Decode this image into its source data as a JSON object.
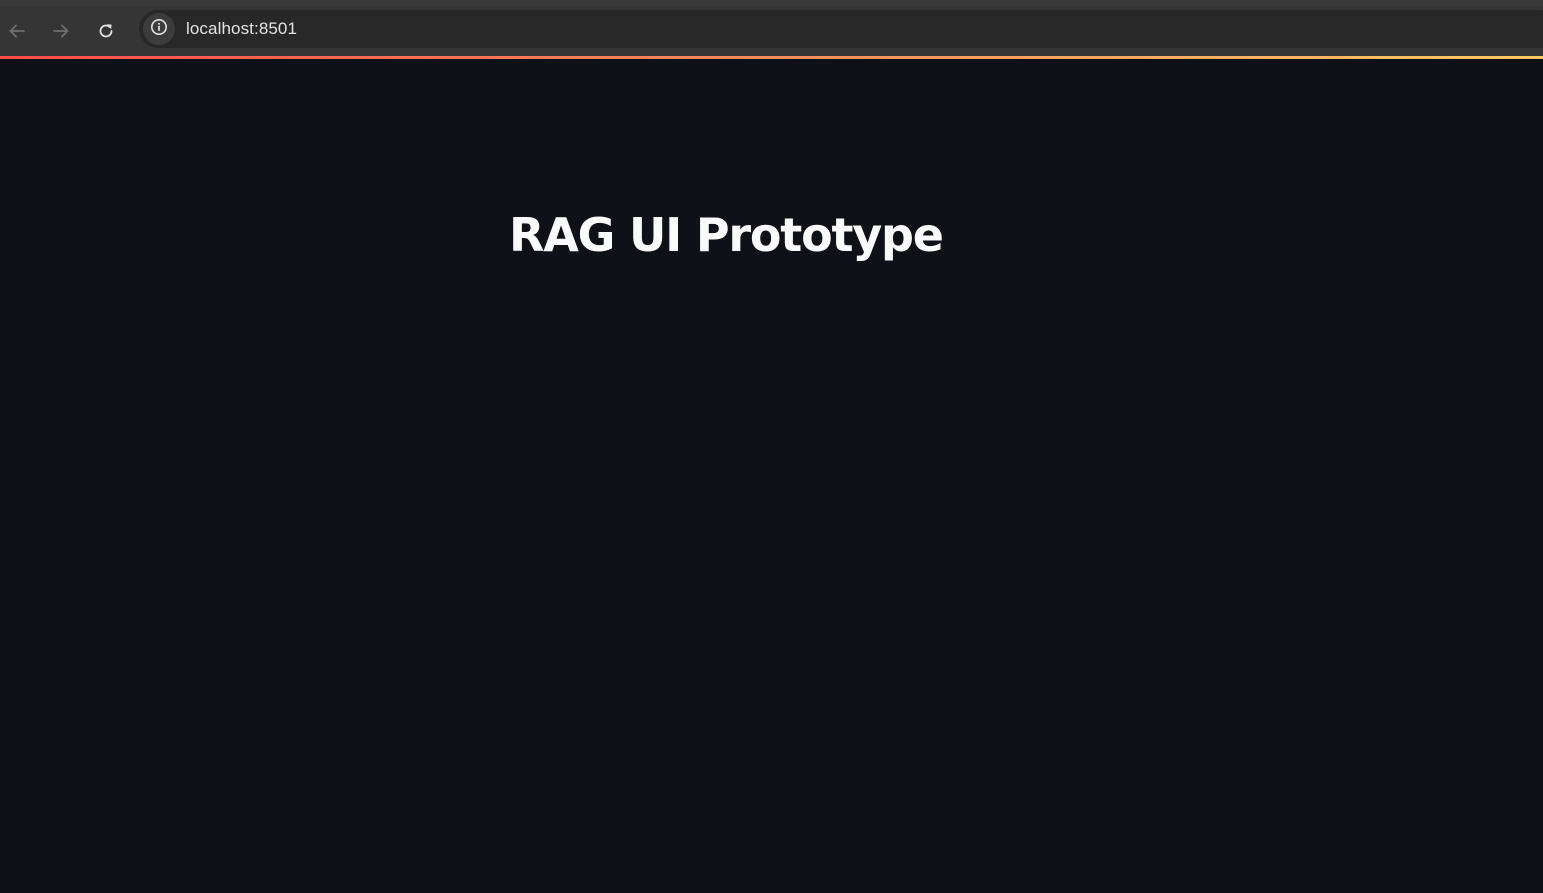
{
  "browser": {
    "url": "localhost:8501",
    "icons": {
      "back": "arrow-left-icon",
      "forward": "arrow-right-icon",
      "reload": "reload-icon",
      "site_info": "info-circle-icon"
    }
  },
  "app": {
    "title": "RAG UI Prototype"
  },
  "colors": {
    "background": "#0e1117",
    "title": "#fafafa",
    "decoration_start": "#ff4b4b",
    "decoration_end": "#ffc862"
  }
}
